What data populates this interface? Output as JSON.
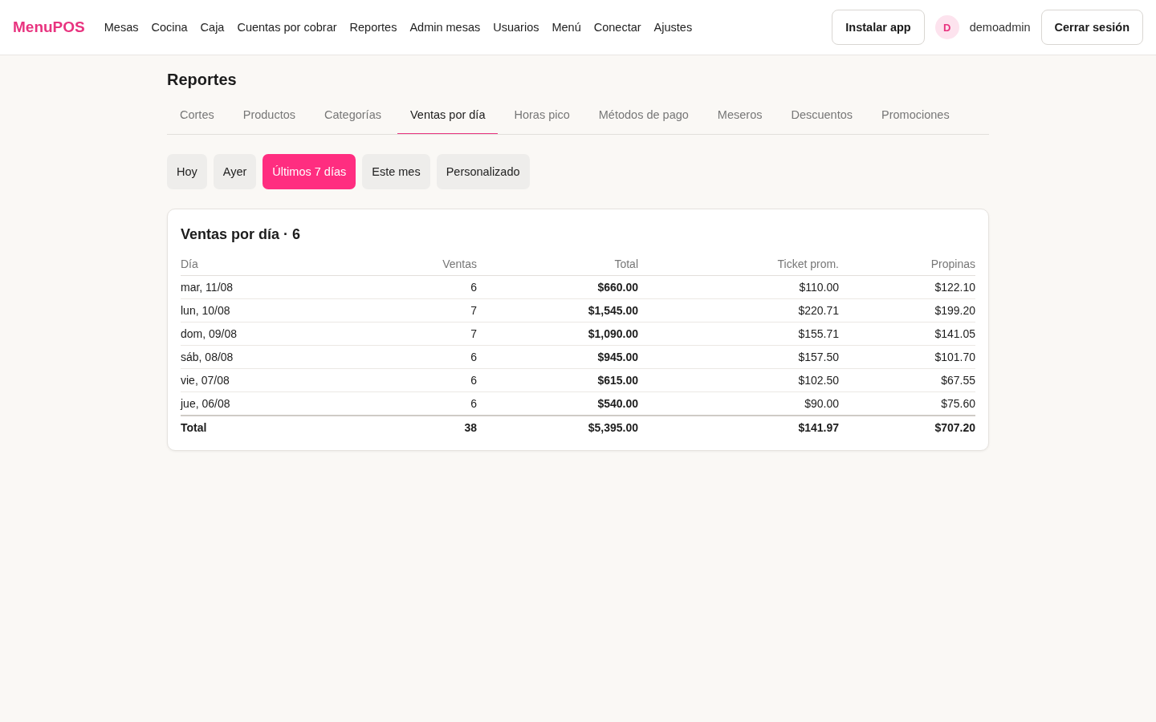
{
  "header": {
    "logo": "MenuPOS",
    "nav": [
      "Mesas",
      "Cocina",
      "Caja",
      "Cuentas por cobrar",
      "Reportes",
      "Admin mesas",
      "Usuarios",
      "Menú",
      "Conectar",
      "Ajustes"
    ],
    "install_button": "Instalar app",
    "user": {
      "initial": "D",
      "name": "demoadmin"
    },
    "logout_button": "Cerrar sesión"
  },
  "page": {
    "title": "Reportes",
    "tabs": [
      {
        "label": "Cortes",
        "selected": false
      },
      {
        "label": "Productos",
        "selected": false
      },
      {
        "label": "Categorías",
        "selected": false
      },
      {
        "label": "Ventas por día",
        "selected": true
      },
      {
        "label": "Horas pico",
        "selected": false
      },
      {
        "label": "Métodos de pago",
        "selected": false
      },
      {
        "label": "Meseros",
        "selected": false
      },
      {
        "label": "Descuentos",
        "selected": false
      },
      {
        "label": "Promociones",
        "selected": false
      }
    ],
    "range_filters": [
      {
        "label": "Hoy",
        "selected": false
      },
      {
        "label": "Ayer",
        "selected": false
      },
      {
        "label": "Últimos 7 días",
        "selected": true
      },
      {
        "label": "Este mes",
        "selected": false
      },
      {
        "label": "Personalizado",
        "selected": false
      }
    ]
  },
  "report": {
    "title": "Ventas por día · 6",
    "columns": [
      "Día",
      "Ventas",
      "Total",
      "Ticket prom.",
      "Propinas"
    ],
    "rows": [
      [
        "mar, 11/08",
        "6",
        "$660.00",
        "$110.00",
        "$122.10"
      ],
      [
        "lun, 10/08",
        "7",
        "$1,545.00",
        "$220.71",
        "$199.20"
      ],
      [
        "dom, 09/08",
        "7",
        "$1,090.00",
        "$155.71",
        "$141.05"
      ],
      [
        "sáb, 08/08",
        "6",
        "$945.00",
        "$157.50",
        "$101.70"
      ],
      [
        "vie, 07/08",
        "6",
        "$615.00",
        "$102.50",
        "$67.55"
      ],
      [
        "jue, 06/08",
        "6",
        "$540.00",
        "$90.00",
        "$75.60"
      ]
    ],
    "total_row": [
      "Total",
      "38",
      "$5,395.00",
      "$141.97",
      "$707.20"
    ]
  }
}
